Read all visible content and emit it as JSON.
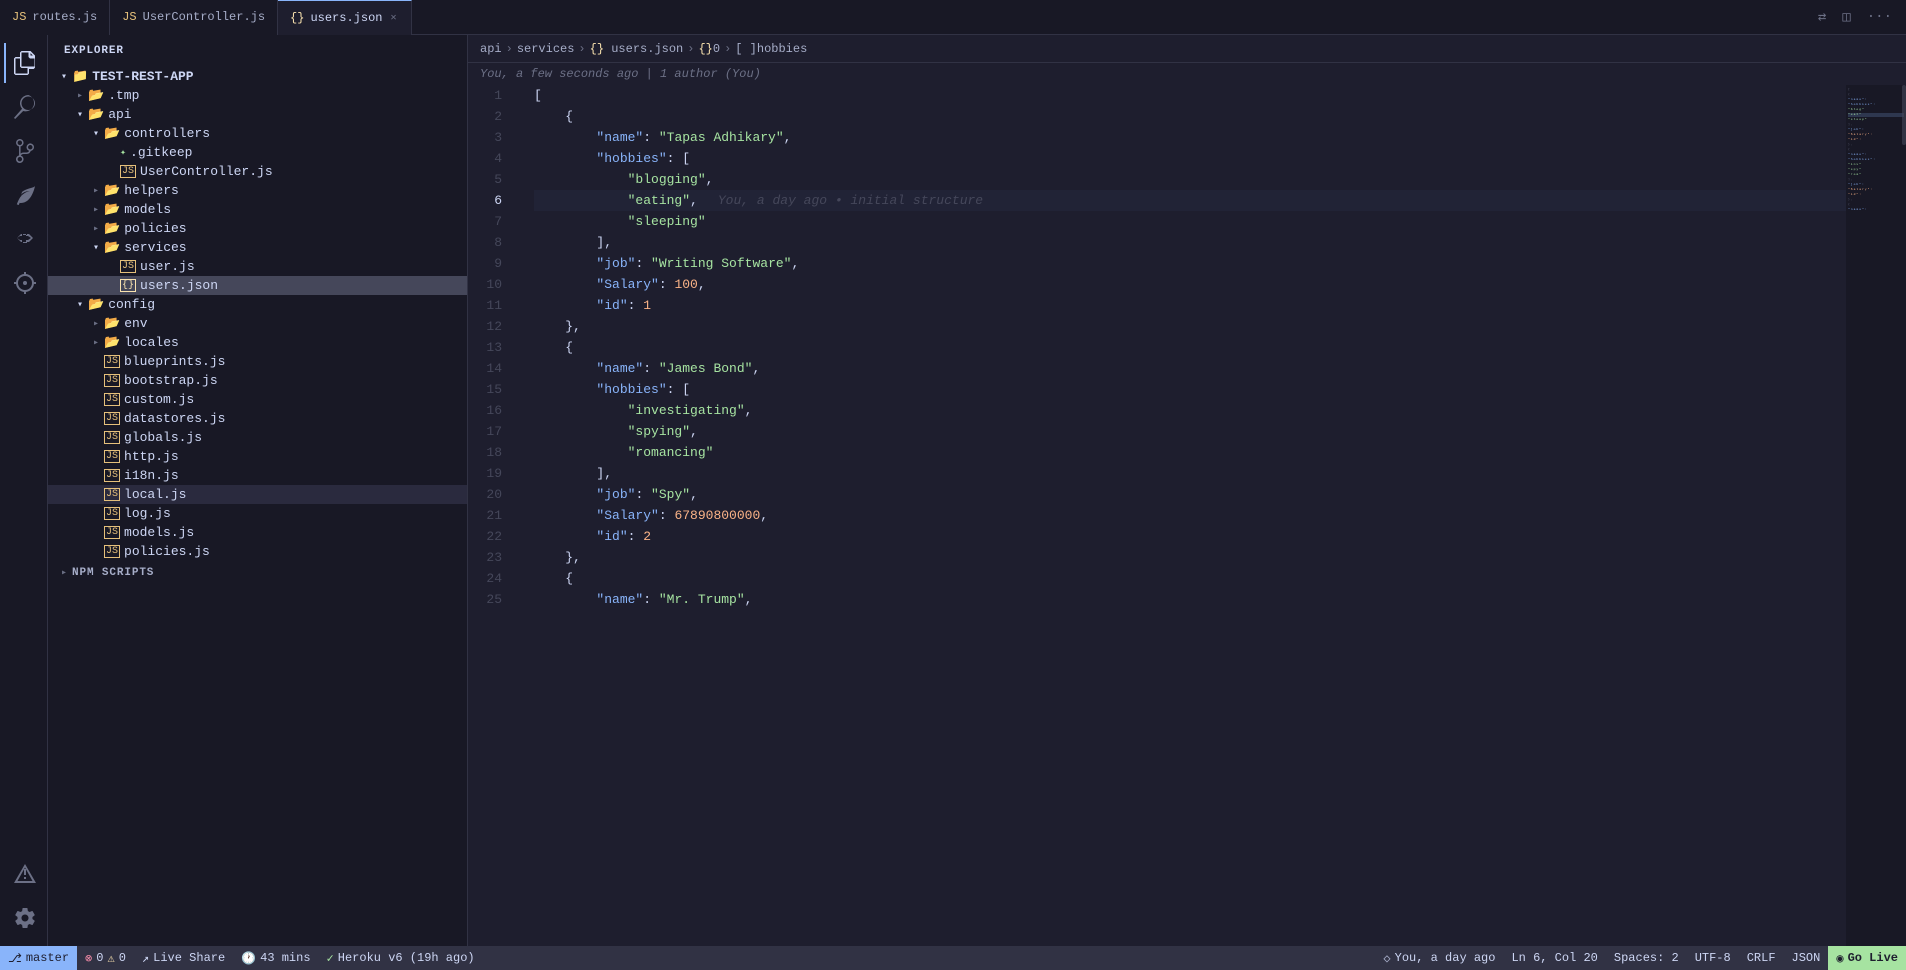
{
  "app": {
    "title": "EXPLORER"
  },
  "tabs": [
    {
      "id": "routes",
      "label": "routes.js",
      "icon": "js",
      "active": false,
      "modified": false
    },
    {
      "id": "user-controller",
      "label": "UserController.js",
      "icon": "js",
      "active": false,
      "modified": false
    },
    {
      "id": "users-json",
      "label": "users.json",
      "icon": "json",
      "active": true,
      "modified": false
    }
  ],
  "breadcrumb": {
    "items": [
      "api",
      "services",
      "{} users.json",
      "{}0",
      "[ ]hobbies"
    ]
  },
  "blame": {
    "text": "You, a few seconds ago | 1 author (You)"
  },
  "sidebar": {
    "project": "TEST-REST-APP",
    "tree": [
      {
        "id": "tmp",
        "label": ".tmp",
        "indent": 1,
        "type": "folder",
        "expanded": false
      },
      {
        "id": "api",
        "label": "api",
        "indent": 1,
        "type": "folder",
        "expanded": true
      },
      {
        "id": "controllers",
        "label": "controllers",
        "indent": 2,
        "type": "folder",
        "expanded": true
      },
      {
        "id": "gitkeep",
        "label": ".gitkeep",
        "indent": 3,
        "type": "file-special"
      },
      {
        "id": "usercontroller",
        "label": "UserController.js",
        "indent": 3,
        "type": "file-js"
      },
      {
        "id": "helpers",
        "label": "helpers",
        "indent": 2,
        "type": "folder",
        "expanded": false
      },
      {
        "id": "models",
        "label": "models",
        "indent": 2,
        "type": "folder",
        "expanded": false
      },
      {
        "id": "policies",
        "label": "policies",
        "indent": 2,
        "type": "folder",
        "expanded": false
      },
      {
        "id": "services",
        "label": "services",
        "indent": 2,
        "type": "folder",
        "expanded": true
      },
      {
        "id": "user-js",
        "label": "user.js",
        "indent": 3,
        "type": "file-js"
      },
      {
        "id": "users-json",
        "label": "users.json",
        "indent": 3,
        "type": "file-json",
        "selected": true
      },
      {
        "id": "config",
        "label": "config",
        "indent": 1,
        "type": "folder",
        "expanded": true
      },
      {
        "id": "env",
        "label": "env",
        "indent": 2,
        "type": "folder",
        "expanded": false
      },
      {
        "id": "locales",
        "label": "locales",
        "indent": 2,
        "type": "folder",
        "expanded": false
      },
      {
        "id": "blueprints",
        "label": "blueprints.js",
        "indent": 2,
        "type": "file-js"
      },
      {
        "id": "bootstrap",
        "label": "bootstrap.js",
        "indent": 2,
        "type": "file-js"
      },
      {
        "id": "custom",
        "label": "custom.js",
        "indent": 2,
        "type": "file-js"
      },
      {
        "id": "datastores",
        "label": "datastores.js",
        "indent": 2,
        "type": "file-js"
      },
      {
        "id": "globals",
        "label": "globals.js",
        "indent": 2,
        "type": "file-js"
      },
      {
        "id": "http",
        "label": "http.js",
        "indent": 2,
        "type": "file-js"
      },
      {
        "id": "i18n",
        "label": "i18n.js",
        "indent": 2,
        "type": "file-js"
      },
      {
        "id": "local",
        "label": "local.js",
        "indent": 2,
        "type": "file-js-active"
      },
      {
        "id": "log",
        "label": "log.js",
        "indent": 2,
        "type": "file-js"
      },
      {
        "id": "models-js",
        "label": "models.js",
        "indent": 2,
        "type": "file-js"
      },
      {
        "id": "policies-js",
        "label": "policies.js",
        "indent": 2,
        "type": "file-js"
      }
    ]
  },
  "npm_scripts": "NPM SCRIPTS",
  "code": {
    "lines": [
      {
        "num": 1,
        "content": "[",
        "type": "bracket"
      },
      {
        "num": 2,
        "content": "    {",
        "type": "bracket"
      },
      {
        "num": 3,
        "content": "        \"name\": \"Tapas Adhikary\",",
        "type": "kv-str",
        "key": "name",
        "value": "Tapas Adhikary"
      },
      {
        "num": 4,
        "content": "        \"hobbies\": [",
        "type": "kv-arr",
        "key": "hobbies"
      },
      {
        "num": 5,
        "content": "            \"blogging\",",
        "type": "arr-str",
        "value": "blogging"
      },
      {
        "num": 6,
        "content": "            \"eating\",",
        "type": "arr-str",
        "value": "eating",
        "blame": "You, a day ago • initial structure"
      },
      {
        "num": 7,
        "content": "            \"sleeping\"",
        "type": "arr-str",
        "value": "sleeping"
      },
      {
        "num": 8,
        "content": "        ],",
        "type": "bracket"
      },
      {
        "num": 9,
        "content": "        \"job\": \"Writing Software\",",
        "type": "kv-str",
        "key": "job",
        "value": "Writing Software"
      },
      {
        "num": 10,
        "content": "        \"Salary\": 100,",
        "type": "kv-num",
        "key": "Salary",
        "value": "100"
      },
      {
        "num": 11,
        "content": "        \"id\": 1",
        "type": "kv-num",
        "key": "id",
        "value": "1"
      },
      {
        "num": 12,
        "content": "    },",
        "type": "bracket"
      },
      {
        "num": 13,
        "content": "    {",
        "type": "bracket"
      },
      {
        "num": 14,
        "content": "        \"name\": \"James Bond\",",
        "type": "kv-str",
        "key": "name",
        "value": "James Bond"
      },
      {
        "num": 15,
        "content": "        \"hobbies\": [",
        "type": "kv-arr",
        "key": "hobbies"
      },
      {
        "num": 16,
        "content": "            \"investigating\",",
        "type": "arr-str",
        "value": "investigating"
      },
      {
        "num": 17,
        "content": "            \"spying\",",
        "type": "arr-str",
        "value": "spying"
      },
      {
        "num": 18,
        "content": "            \"romancing\"",
        "type": "arr-str",
        "value": "romancing"
      },
      {
        "num": 19,
        "content": "        ],",
        "type": "bracket"
      },
      {
        "num": 20,
        "content": "        \"job\": \"Spy\",",
        "type": "kv-str",
        "key": "job",
        "value": "Spy"
      },
      {
        "num": 21,
        "content": "        \"Salary\": 67890800000,",
        "type": "kv-num",
        "key": "Salary",
        "value": "67890800000"
      },
      {
        "num": 22,
        "content": "        \"id\": 2",
        "type": "kv-num",
        "key": "id",
        "value": "2"
      },
      {
        "num": 23,
        "content": "    },",
        "type": "bracket"
      },
      {
        "num": 24,
        "content": "    {",
        "type": "bracket"
      },
      {
        "num": 25,
        "content": "        \"name\": \"Mr. Trump\",",
        "type": "kv-str",
        "key": "name",
        "value": "Mr. Trump"
      }
    ]
  },
  "status_bar": {
    "branch": "master",
    "errors": "0",
    "warnings": "0",
    "live_share": "Live Share",
    "time": "43 mins",
    "heroku": "Heroku v6 (19h ago)",
    "blame_right": "You, a day ago",
    "ln": "Ln 6, Col 20",
    "spaces": "Spaces: 2",
    "encoding": "UTF-8",
    "line_ending": "CRLF",
    "language": "JSON",
    "go_live": "Go Live"
  },
  "icons": {
    "explorer": "⊞",
    "search": "🔍",
    "source_control": "⑂",
    "run_debug": "▷",
    "extensions": "⊞",
    "remote": "⊗",
    "warnings": "⚠",
    "settings": "⚙"
  }
}
